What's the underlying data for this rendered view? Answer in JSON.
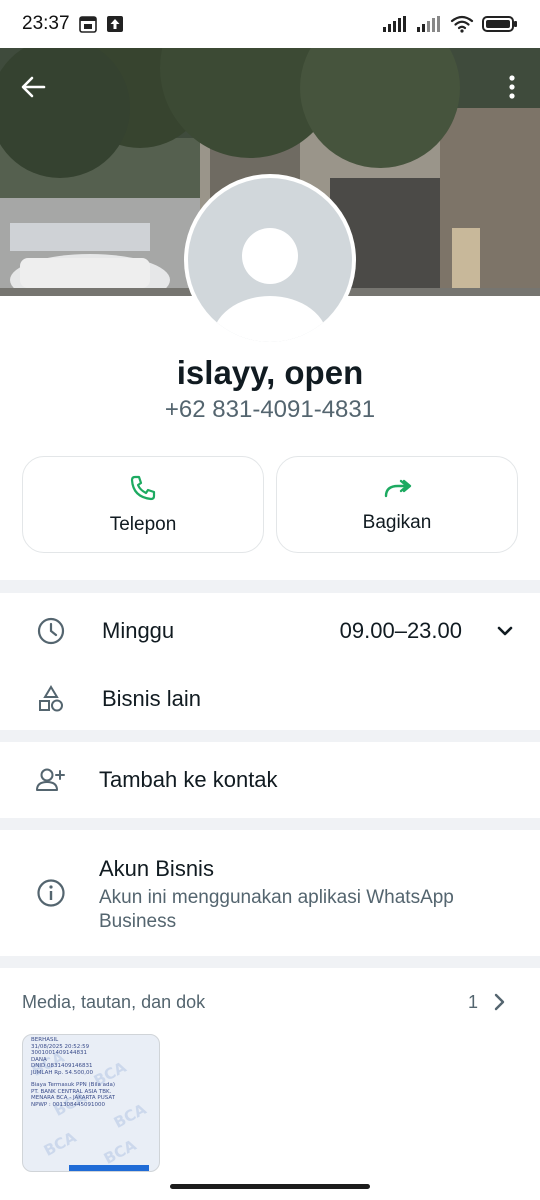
{
  "status_bar": {
    "time": "23:37",
    "battery_icon": "battery-full-icon",
    "wifi_icon": "wifi-icon"
  },
  "header": {
    "back_icon": "arrow-back-icon",
    "menu_icon": "more-vert-icon"
  },
  "profile": {
    "name": "islayy, open",
    "phone": "+62 831-4091-4831"
  },
  "actions": [
    {
      "label": "Telepon",
      "icon": "phone-icon"
    },
    {
      "label": "Bagikan",
      "icon": "share-forward-icon"
    }
  ],
  "hours": {
    "day": "Minggu",
    "time": "09.00–23.00"
  },
  "other_business": {
    "label": "Bisnis lain"
  },
  "add_contact": {
    "label": "Tambah ke kontak"
  },
  "business_account": {
    "title": "Akun Bisnis",
    "description": "Akun ini menggunakan aplikasi WhatsApp Business"
  },
  "media": {
    "title": "Media, tautan, dan dok",
    "count": "1",
    "thumbnail_lines": [
      "BERHASIL",
      "31/08/2025 20:52:59",
      "3001001409144831",
      "DANA",
      "DNID 0831409146831",
      "JUMLAH Rp. 54.500,00",
      "",
      "Biaya Termasuk PPN (Bila ada)",
      "PT. BANK CENTRAL ASIA TBK.",
      "MENARA BCA - JAKARTA PUSAT",
      "NPWP : 001308445091000"
    ],
    "watermark": "BCA"
  },
  "colors": {
    "accent_green": "#1daa61",
    "icon_gray": "#54656f",
    "bg": "#f0f2f5"
  }
}
